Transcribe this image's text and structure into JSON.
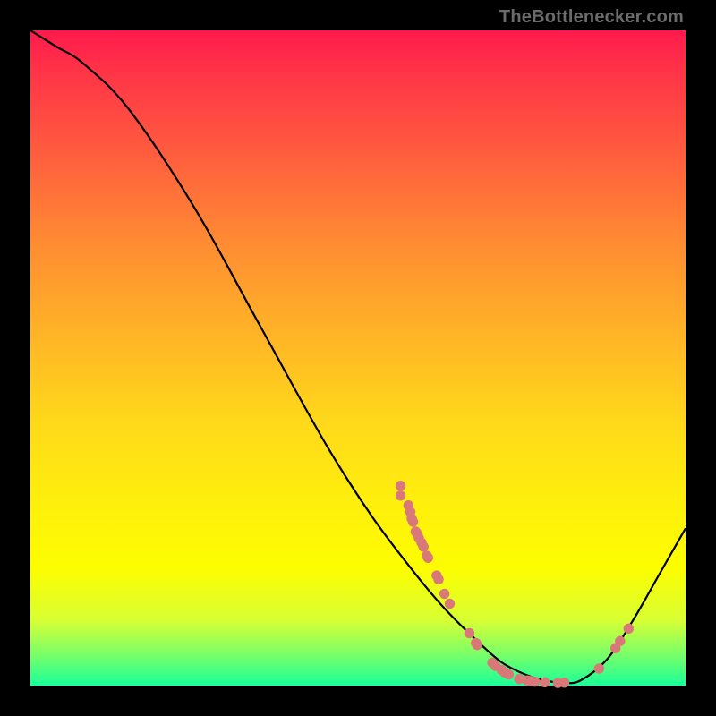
{
  "watermark": "TheBottlenecker.com",
  "chart_data": {
    "type": "line",
    "title": "",
    "xlabel": "",
    "ylabel": "",
    "xlim": [
      0,
      100
    ],
    "ylim": [
      0,
      100
    ],
    "curve": [
      {
        "x": 0,
        "y": 100
      },
      {
        "x": 4,
        "y": 97.5
      },
      {
        "x": 8,
        "y": 95
      },
      {
        "x": 15,
        "y": 88
      },
      {
        "x": 25,
        "y": 73
      },
      {
        "x": 35,
        "y": 55
      },
      {
        "x": 45,
        "y": 37
      },
      {
        "x": 52,
        "y": 26
      },
      {
        "x": 58,
        "y": 18
      },
      {
        "x": 63,
        "y": 12
      },
      {
        "x": 68,
        "y": 7
      },
      {
        "x": 72,
        "y": 3.5
      },
      {
        "x": 76,
        "y": 1.5
      },
      {
        "x": 79,
        "y": 0.7
      },
      {
        "x": 81.5,
        "y": 0.4
      },
      {
        "x": 84,
        "y": 0.8
      },
      {
        "x": 88,
        "y": 4
      },
      {
        "x": 92,
        "y": 10
      },
      {
        "x": 96,
        "y": 17
      },
      {
        "x": 100,
        "y": 24
      }
    ],
    "points": [
      {
        "x": 56.5,
        "y": 30.5
      },
      {
        "x": 56.5,
        "y": 29.0
      },
      {
        "x": 57.7,
        "y": 27.5
      },
      {
        "x": 58.0,
        "y": 26.5
      },
      {
        "x": 58.2,
        "y": 25.5
      },
      {
        "x": 58.4,
        "y": 25.0
      },
      {
        "x": 58.8,
        "y": 23.5
      },
      {
        "x": 59.1,
        "y": 23.1
      },
      {
        "x": 59.3,
        "y": 22.5
      },
      {
        "x": 59.7,
        "y": 21.8
      },
      {
        "x": 60.0,
        "y": 21.2
      },
      {
        "x": 60.5,
        "y": 19.8
      },
      {
        "x": 60.7,
        "y": 19.5
      },
      {
        "x": 62.0,
        "y": 16.8
      },
      {
        "x": 62.3,
        "y": 16.2
      },
      {
        "x": 63.2,
        "y": 14.0
      },
      {
        "x": 64.0,
        "y": 12.5
      },
      {
        "x": 67.0,
        "y": 8.0
      },
      {
        "x": 68.0,
        "y": 6.5
      },
      {
        "x": 68.2,
        "y": 6.2
      },
      {
        "x": 70.5,
        "y": 3.5
      },
      {
        "x": 71.0,
        "y": 3.0
      },
      {
        "x": 71.9,
        "y": 2.4
      },
      {
        "x": 72.4,
        "y": 2.0
      },
      {
        "x": 73.0,
        "y": 1.7
      },
      {
        "x": 74.6,
        "y": 1.0
      },
      {
        "x": 75.8,
        "y": 0.8
      },
      {
        "x": 76.3,
        "y": 0.7
      },
      {
        "x": 77.0,
        "y": 0.6
      },
      {
        "x": 78.5,
        "y": 0.5
      },
      {
        "x": 80.5,
        "y": 0.4
      },
      {
        "x": 81.5,
        "y": 0.45
      },
      {
        "x": 86.8,
        "y": 2.6
      },
      {
        "x": 89.3,
        "y": 5.7
      },
      {
        "x": 90.0,
        "y": 6.8
      },
      {
        "x": 91.3,
        "y": 8.7
      }
    ]
  }
}
